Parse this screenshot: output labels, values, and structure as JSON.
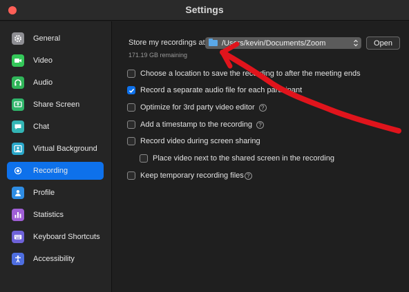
{
  "window": {
    "title": "Settings"
  },
  "sidebar": {
    "items": [
      {
        "label": "General",
        "icon": "gear-icon",
        "color": "#8e8e93",
        "active": false
      },
      {
        "label": "Video",
        "icon": "video-camera-icon",
        "color": "#34c759",
        "active": false
      },
      {
        "label": "Audio",
        "icon": "headphones-icon",
        "color": "#30b559",
        "active": false
      },
      {
        "label": "Share Screen",
        "icon": "share-screen-icon",
        "color": "#2fb56a",
        "active": false
      },
      {
        "label": "Chat",
        "icon": "chat-bubble-icon",
        "color": "#33b5b5",
        "active": false
      },
      {
        "label": "Virtual Background",
        "icon": "person-background-icon",
        "color": "#2aa7c9",
        "active": false
      },
      {
        "label": "Recording",
        "icon": "record-icon",
        "color": "#0e71eb",
        "active": true
      },
      {
        "label": "Profile",
        "icon": "profile-icon",
        "color": "#2f8de4",
        "active": false
      },
      {
        "label": "Statistics",
        "icon": "bar-chart-icon",
        "color": "#a05fd6",
        "active": false
      },
      {
        "label": "Keyboard Shortcuts",
        "icon": "keyboard-icon",
        "color": "#6e62d9",
        "active": false
      },
      {
        "label": "Accessibility",
        "icon": "accessibility-icon",
        "color": "#4e6ee0",
        "active": false
      }
    ]
  },
  "recording": {
    "store_label": "Store my recordings at:",
    "path": "/Users/kevin/Documents/Zoom",
    "open_label": "Open",
    "remaining": "171.19 GB remaining",
    "options": [
      {
        "label": "Choose a location to save the recording to after the meeting ends",
        "checked": false,
        "help": false
      },
      {
        "label": "Record a separate audio file for each participant",
        "checked": true,
        "help": false
      },
      {
        "label": "Optimize for 3rd party video editor",
        "checked": false,
        "help": true
      },
      {
        "label": "Add a timestamp to the recording",
        "checked": false,
        "help": true
      },
      {
        "label": "Record video during screen sharing",
        "checked": false,
        "help": false
      },
      {
        "label": "Place video next to the shared screen in the recording",
        "checked": false,
        "help": false
      },
      {
        "label": "Keep temporary recording files",
        "checked": false,
        "help": true
      }
    ]
  },
  "colors": {
    "accent": "#0e71eb",
    "annotation": "#e0141c"
  }
}
